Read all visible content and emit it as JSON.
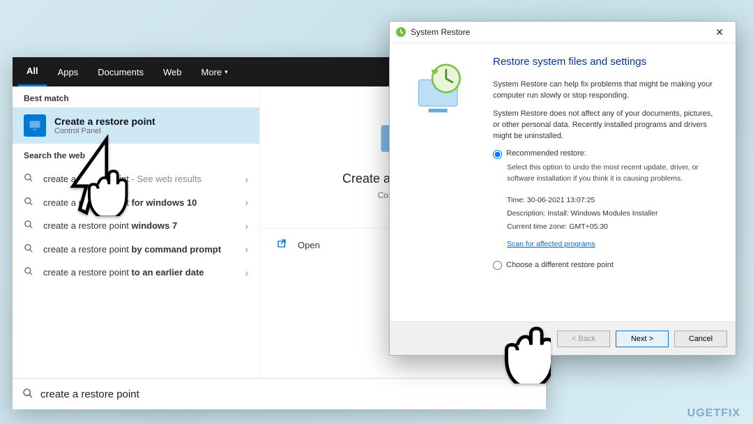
{
  "search": {
    "tabs": [
      "All",
      "Apps",
      "Documents",
      "Web",
      "More"
    ],
    "best_match_label": "Best match",
    "best_match": {
      "title": "Create a restore point",
      "subtitle": "Control Panel"
    },
    "web_label": "Search the web",
    "web_results": [
      {
        "prefix": "create a ",
        "bold": "",
        "suffix": "",
        "hint": " - See web results",
        "raw": "create a restore point"
      },
      {
        "prefix": "create a restore point ",
        "bold": "for windows 10",
        "suffix": "",
        "hint": ""
      },
      {
        "prefix": "create a restore point ",
        "bold": "windows 7",
        "suffix": "",
        "hint": ""
      },
      {
        "prefix": "create a restore point ",
        "bold": "by command prompt",
        "suffix": "",
        "hint": ""
      },
      {
        "prefix": "create a restore point ",
        "bold": "to an earlier date",
        "suffix": "",
        "hint": ""
      }
    ],
    "right_pane": {
      "title": "Create a restore point",
      "subtitle": "Control Panel",
      "open_label": "Open"
    },
    "input_value": "create a restore point"
  },
  "restore": {
    "window_title": "System Restore",
    "heading": "Restore system files and settings",
    "p1": "System Restore can help fix problems that might be making your computer run slowly or stop responding.",
    "p2": "System Restore does not affect any of your documents, pictures, or other personal data. Recently installed programs and drivers might be uninstalled.",
    "opt1_label": "Recommended restore:",
    "opt1_desc": "Select this option to undo the most recent update, driver, or software installation if you think it is causing problems.",
    "info_time": "Time: 30-06-2021 13:07:25",
    "info_desc": "Description: Install: Windows Modules Installer",
    "info_tz": "Current time zone: GMT+05:30",
    "scan_link": "Scan for affected programs",
    "opt2_label": "Choose a different restore point",
    "btn_back": "< Back",
    "btn_next": "Next >",
    "btn_cancel": "Cancel"
  },
  "watermark": "UGETFIX"
}
